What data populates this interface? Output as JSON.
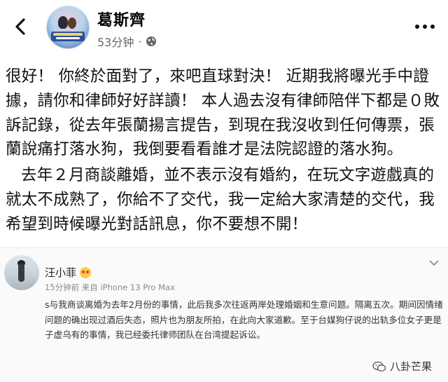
{
  "header": {
    "back_icon": "chevron-left-icon",
    "author_name": "葛斯齊",
    "timestamp": "53分钟",
    "separator": "·",
    "privacy_icon": "globe-icon",
    "more_icon": "more-horizontal-icon"
  },
  "post": {
    "paragraph1": "很好！ 你終於面對了，來吧直球對決！ 近期我將曝光手中證據，請你和律師好好詳讀！ 本人過去沒有律師陪伴下都是０敗訴記錄，從去年張蘭揚言提告，到現在我沒收到任何傳票，張蘭說痛打落水狗，我倒要看看誰才是法院認證的落水狗。",
    "paragraph2": "去年２月商談離婚，並不表示沒有婚約，在玩文字遊戲真的就太不成熟了，你給不了交代，我一定給大家清楚的交代，我希望到時候曝光對話訊息，你不要想不開！"
  },
  "shared_post": {
    "author_name": "汪小菲",
    "meta": "15分钟前 来自 iPhone 13 Pro Max",
    "body": "s与我商谈离婚为去年2月份的事情，此后我多次往返两岸处理婚姻和生意问题。隔离五次。期间因情绪问题的确出现过酒后失态，照片也为朋友所拍，在此向大家道歉。至于台媒狗仔说的出轨多位女子更是子虚乌有的事情，我已经委托律师团队在台湾提起诉讼。",
    "dropdown_icon": "chevron-down-icon"
  },
  "watermark": {
    "text": "八卦芒果",
    "icon": "wechat-icon"
  },
  "colors": {
    "text": "#111111",
    "meta": "#65676b",
    "watermark": "#333333"
  }
}
